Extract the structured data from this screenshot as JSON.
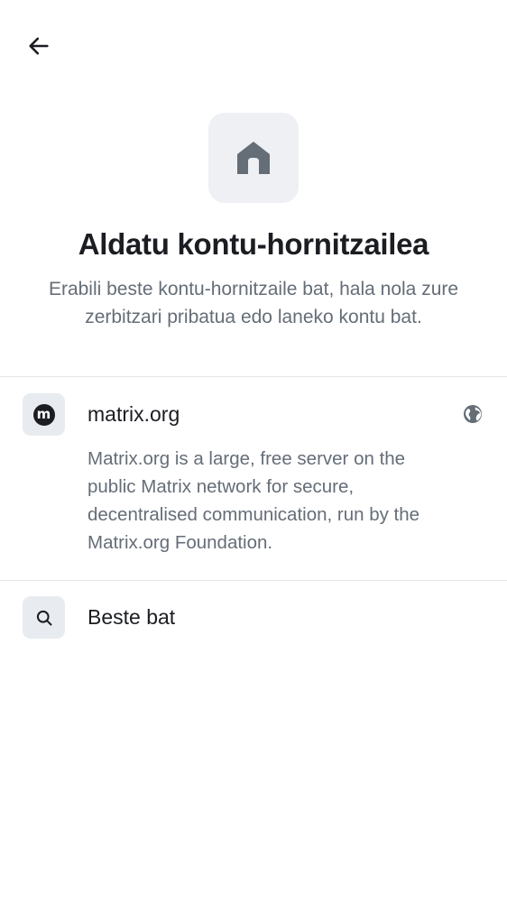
{
  "header": {
    "back_icon": "arrow-left-icon"
  },
  "hero": {
    "icon": "home-icon",
    "title": "Aldatu kontu-hornitzailea",
    "subtitle": "Erabili beste kontu-hornitzaile bat, hala nola zure zerbitzari pribatua edo laneko kontu bat."
  },
  "providers": [
    {
      "icon": "matrix-logo-icon",
      "name": "matrix.org",
      "description": "Matrix.org is a large, free server on the public Matrix network for secure, decentralised communication, run by the Matrix.org Foundation.",
      "trailing_icon": "globe-icon"
    },
    {
      "icon": "search-icon",
      "name": "Beste bat"
    }
  ],
  "colors": {
    "text_primary": "#1b1d22",
    "text_secondary": "#656d77",
    "icon_bg": "#eef0f4",
    "divider": "#e3e5e9"
  }
}
